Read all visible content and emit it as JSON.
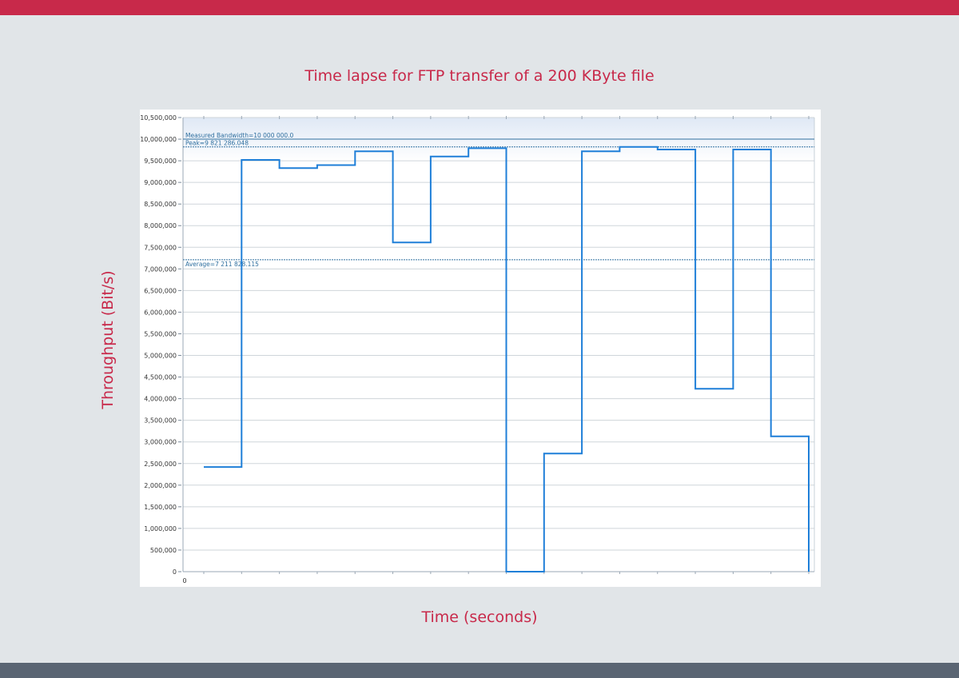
{
  "page": {
    "title": "Time lapse for FTP transfer of a 200 KByte file",
    "xlabel": "Time (seconds)",
    "ylabel": "Throughput (Bit/s)"
  },
  "colors": {
    "accent": "#c8294a",
    "background": "#e1e5e8",
    "footer": "#5a6573",
    "series": "#1f7fd8",
    "reference_line": "#2f6f9f",
    "grid": "#cfd5da"
  },
  "chart_data": {
    "type": "line",
    "step": true,
    "title": "Time lapse for FTP transfer of a 200 KByte file",
    "xlabel": "Time (seconds)",
    "ylabel": "Throughput (Bit/s)",
    "ylim": [
      0,
      10500000
    ],
    "grid": true,
    "y_ticks": [
      0,
      500000,
      1000000,
      1500000,
      2000000,
      2500000,
      3000000,
      3500000,
      4000000,
      4500000,
      5000000,
      5500000,
      6000000,
      6500000,
      7000000,
      7500000,
      8000000,
      8500000,
      9000000,
      9500000,
      10000000,
      10500000
    ],
    "y_tick_labels": [
      "0",
      "500,000",
      "1,000,000",
      "1,500,000",
      "2,000,000",
      "2,500,000",
      "3,000,000",
      "3,500,000",
      "4,000,000",
      "4,500,000",
      "5,000,000",
      "5,500,000",
      "6,000,000",
      "6,500,000",
      "7,000,000",
      "7,500,000",
      "8,000,000",
      "8,500,000",
      "9,000,000",
      "9,500,000",
      "10,000,000",
      "10,500,000"
    ],
    "x_tick_labels": [
      "0"
    ],
    "series": [
      {
        "values": [
          2420000,
          9520000,
          9330000,
          9400000,
          9720000,
          7610000,
          9600000,
          9790000,
          0,
          2730000,
          9720000,
          9821286,
          9760000,
          4230000,
          9760000,
          3130000
        ]
      }
    ],
    "reference_lines": [
      {
        "label": "Measured Bandwidth=10 000 000.0",
        "value": 10000000
      },
      {
        "label": "Peak=9 821 286.048",
        "value": 9821286.048
      },
      {
        "label": "Average=7 211 828.115",
        "value": 7211828.115
      }
    ]
  }
}
